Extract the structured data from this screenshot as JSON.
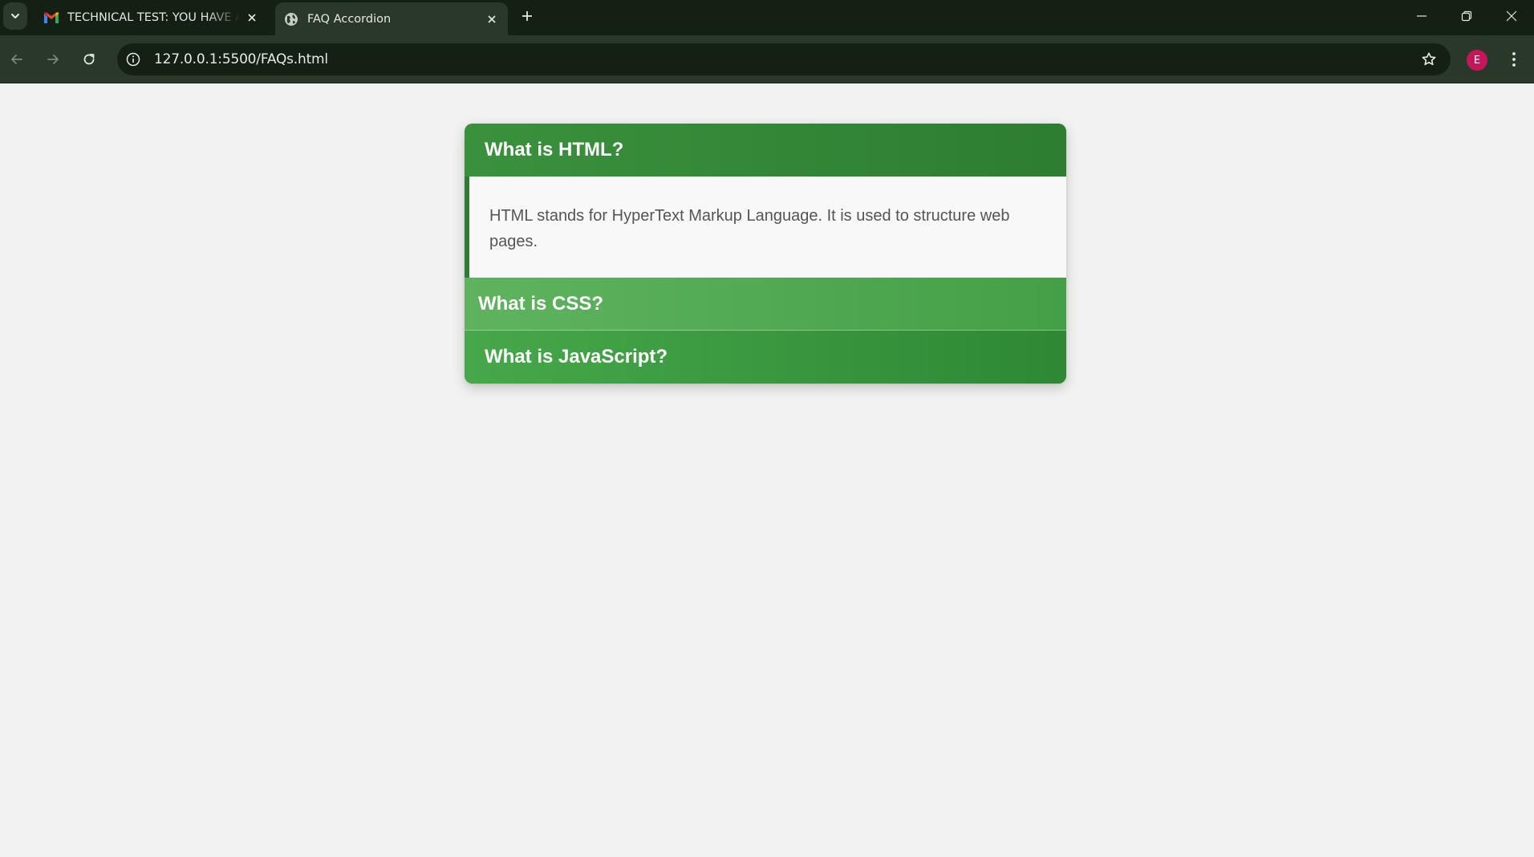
{
  "browser": {
    "tabs": [
      {
        "title": "TECHNICAL TEST: YOU HAVE A",
        "favicon": "gmail-icon",
        "active": false
      },
      {
        "title": "FAQ Accordion",
        "favicon": "globe-icon",
        "active": true
      }
    ],
    "url": "127.0.0.1:5500/FAQs.html",
    "profile_initial": "E",
    "colors": {
      "chrome_dark": "#152015",
      "chrome_toolbar": "#2a382a",
      "profile": "#c2185b"
    }
  },
  "faq": {
    "items": [
      {
        "question": "What is HTML?",
        "answer": "HTML stands for HyperText Markup Language. It is used to structure web pages.",
        "expanded": true
      },
      {
        "question": "What is CSS?",
        "answer": "",
        "expanded": false,
        "hovered": true
      },
      {
        "question": "What is JavaScript?",
        "answer": "",
        "expanded": false
      }
    ],
    "colors": {
      "header": "#2e7d32",
      "header_hover": "#5fb35f",
      "answer_bg": "#f8f8f8",
      "answer_text": "#555555",
      "page_bg": "#f2f2f2"
    }
  }
}
